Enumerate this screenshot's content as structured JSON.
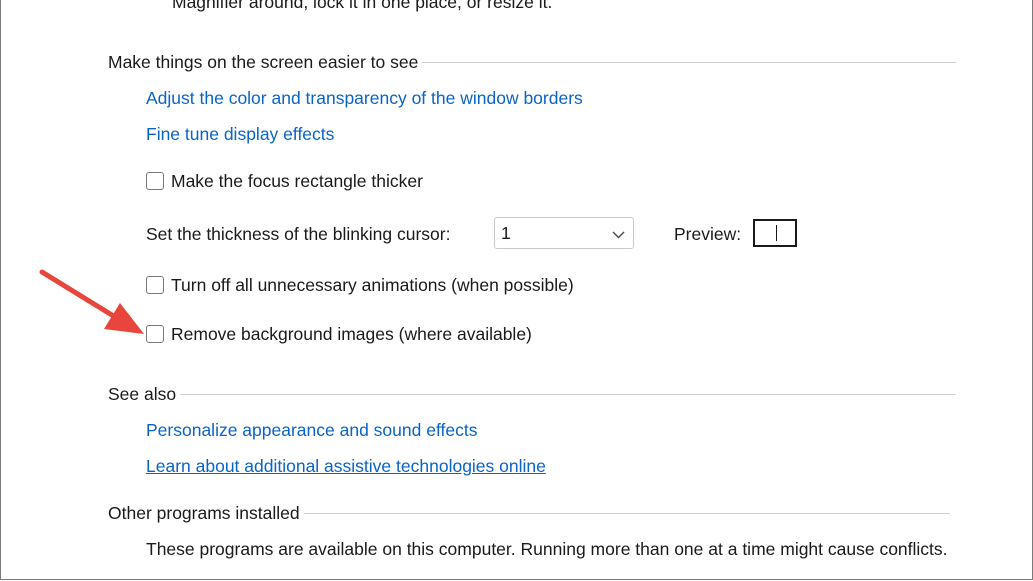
{
  "top_fragment": "Magnifier around, lock it in one place, or resize it.",
  "section_easier": {
    "heading": "Make things on the screen easier to see",
    "link_borders": "Adjust the color and transparency of the window borders",
    "link_display": "Fine tune display effects",
    "chk_focus_label": "Make the focus rectangle thicker",
    "cursor_label": "Set the thickness of the blinking cursor:",
    "cursor_value": "1",
    "preview_label": "Preview:",
    "chk_animations_label": "Turn off all unnecessary animations (when possible)",
    "chk_background_label": "Remove background images (where available)"
  },
  "section_see_also": {
    "heading": "See also",
    "link_personalize": "Personalize appearance and sound effects",
    "link_assistive": "Learn about additional assistive technologies online"
  },
  "section_other": {
    "heading": "Other programs installed",
    "description": "These programs are available on this computer. Running more than one at a time might cause conflicts."
  },
  "icons": {
    "dropdown": "chevron-down-icon",
    "annotation": "red-arrow-icon"
  },
  "colors": {
    "link": "#0a64c8",
    "arrow": "#e8453c"
  }
}
